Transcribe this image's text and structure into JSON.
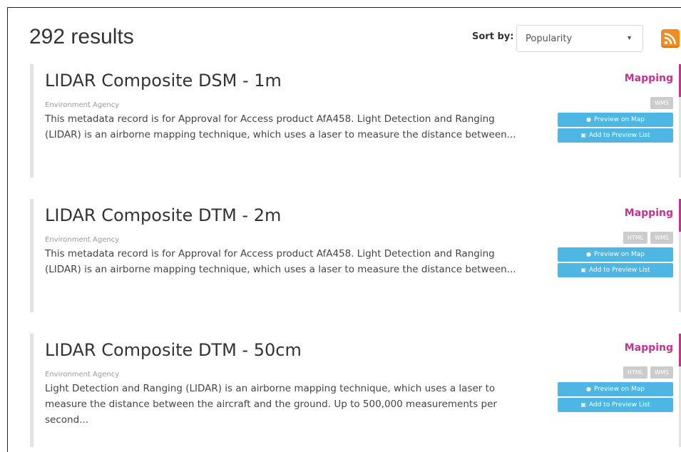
{
  "header": {
    "results_count": "292 results",
    "sort_label": "Sort by:",
    "sort_value": "Popularity"
  },
  "results": [
    {
      "title": "LIDAR Composite DSM - 1m",
      "publisher": "Environment Agency",
      "description": "This metadata record is for Approval for Access product AfA458. Light Detection and Ranging (LIDAR) is an airborne mapping technique, which uses a laser to measure the distance between...",
      "category": "Mapping",
      "badges": [
        "WMS"
      ],
      "preview_label": "Preview on Map",
      "add_label": "Add to Preview List"
    },
    {
      "title": "LIDAR Composite DTM - 2m",
      "publisher": "Environment Agency",
      "description": "This metadata record is for Approval for Access product AfA458. Light Detection and Ranging (LIDAR) is an airborne mapping technique, which uses a laser to measure the distance between...",
      "category": "Mapping",
      "badges": [
        "HTML",
        "WMS"
      ],
      "preview_label": "Preview on Map",
      "add_label": "Add to Preview List"
    },
    {
      "title": "LIDAR Composite DTM - 50cm",
      "publisher": "Environment Agency",
      "description": "Light Detection and Ranging (LIDAR) is an airborne mapping technique, which uses a laser to measure the distance between the aircraft and the ground. Up to 500,000 measurements per second...",
      "category": "Mapping",
      "badges": [
        "HTML",
        "WMS"
      ],
      "preview_label": "Preview on Map",
      "add_label": "Add to Preview List"
    }
  ],
  "icons": {
    "rss": "rss-icon",
    "map_marker": "map-marker-icon",
    "cart": "cart-icon",
    "caret": "caret-down-icon"
  },
  "colors": {
    "accent": "#c2358f",
    "button": "#4db6e3",
    "badge": "#cccccc",
    "rss": "#f28b20"
  }
}
